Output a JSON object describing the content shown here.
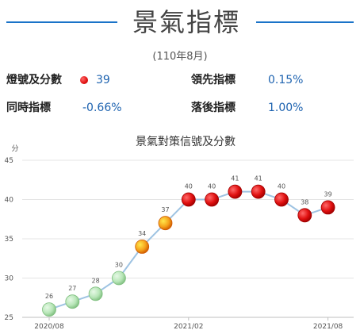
{
  "header": {
    "title": "景氣指標",
    "period": "(110年8月)"
  },
  "indicators": {
    "signal_label": "燈號及分數",
    "signal_score": "39",
    "signal_color": "#e01010",
    "leading_label": "領先指標",
    "leading_value": "0.15%",
    "coincident_label": "同時指標",
    "coincident_value": "-0.66%",
    "lagging_label": "落後指標",
    "lagging_value": "1.00%"
  },
  "chart_data": {
    "type": "line",
    "title": "景氣對策信號及分數",
    "ylabel": "分",
    "ylim": [
      25,
      45
    ],
    "yticks": [
      25,
      30,
      35,
      40,
      45
    ],
    "x_tick_labels": [
      {
        "index": 0,
        "label": "2020/08"
      },
      {
        "index": 6,
        "label": "2021/02"
      },
      {
        "index": 12,
        "label": "2021/08"
      }
    ],
    "x": [
      "2020/08",
      "2020/09",
      "2020/10",
      "2020/11",
      "2020/12",
      "2021/01",
      "2021/02",
      "2021/03",
      "2021/04",
      "2021/05",
      "2021/06",
      "2021/07",
      "2021/08"
    ],
    "values": [
      26,
      27,
      28,
      30,
      34,
      37,
      40,
      40,
      41,
      41,
      40,
      38,
      39
    ],
    "signals": [
      "blue-green",
      "blue-green",
      "blue-green",
      "blue-green",
      "yellow-red",
      "yellow-red",
      "red",
      "red",
      "red",
      "red",
      "red",
      "red",
      "red"
    ],
    "signal_colors": {
      "blue-green": [
        "#e6f9e6",
        "#b8e6b8",
        "#7fbf7f"
      ],
      "yellow-red": [
        "#ffe84d",
        "#f5a21b",
        "#d05a00"
      ],
      "red": [
        "#ff6a6a",
        "#e01010",
        "#a00000"
      ]
    },
    "line_color": "#9ec3e2",
    "grid": true
  }
}
